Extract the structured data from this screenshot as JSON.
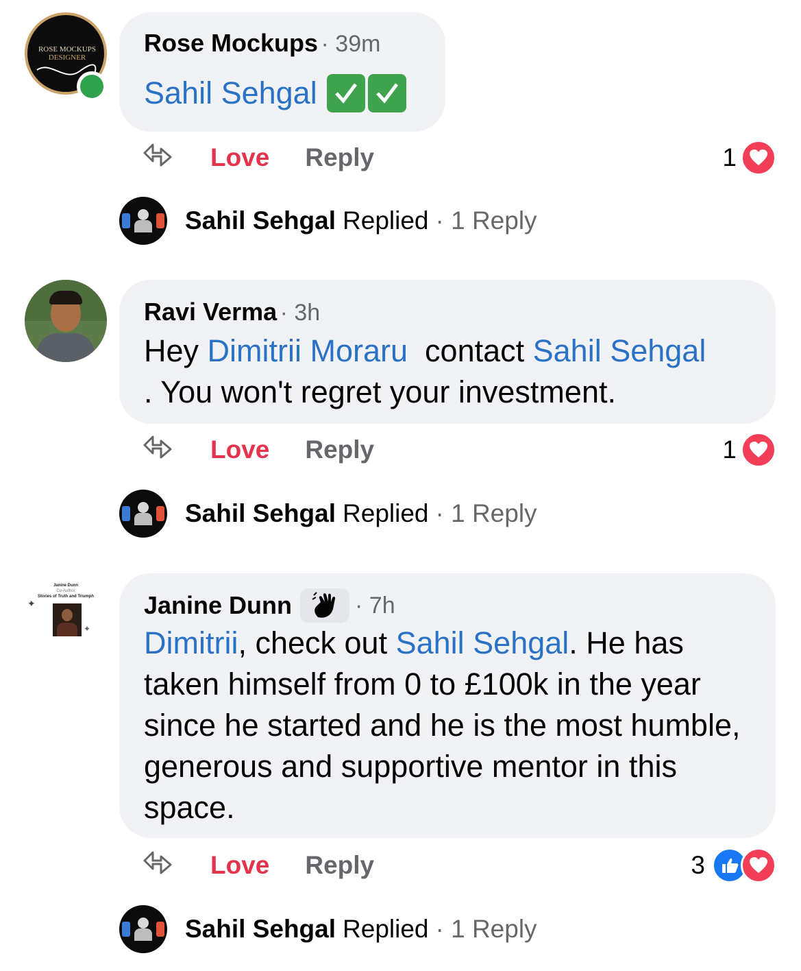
{
  "comments": [
    {
      "author": "Rose Mockups",
      "time": "· 39m",
      "avatar_text": [
        "ROSE MOCKUPS",
        "DESIGNER"
      ],
      "body_mention": "Sahil Sehgal",
      "online": true,
      "actions": {
        "love": "Love",
        "reply": "Reply"
      },
      "reaction_count": "1",
      "replied": {
        "name": "Sahil Sehgal",
        "word": "Replied",
        "count": "· 1 Reply"
      }
    },
    {
      "author": "Ravi Verma",
      "time": "· 3h",
      "body_parts": [
        "Hey ",
        "Dimitrii Moraru",
        "  contact ",
        "Sahil Sehgal",
        ". You won't regret your investment."
      ],
      "actions": {
        "love": "Love",
        "reply": "Reply"
      },
      "reaction_count": "1",
      "replied": {
        "name": "Sahil Sehgal",
        "word": "Replied",
        "count": "· 1 Reply"
      }
    },
    {
      "author": "Janine Dunn",
      "time": "· 7h",
      "avatar_text": [
        "Janine Dunn",
        "Co-Author",
        "Stories of Truth and Triumph"
      ],
      "body_parts": [
        "Dimitrii",
        ", check out ",
        "Sahil Sehgal",
        ". He has taken himself from 0 to £100k in the year since he started and he is the most humble, generous and supportive mentor in this space."
      ],
      "actions": {
        "love": "Love",
        "reply": "Reply"
      },
      "reaction_count": "3",
      "replied": {
        "name": "Sahil Sehgal",
        "word": "Replied",
        "count": "· 1 Reply"
      }
    }
  ],
  "icons": {
    "share": "share-icon",
    "heart": "heart-reaction-icon",
    "like": "like-reaction-icon",
    "wave": "wave-badge-icon",
    "check": "check-mark-icon"
  },
  "colors": {
    "mention": "#2a72c5",
    "love": "#e4334c",
    "bubble": "#f0f2f5",
    "online": "#31a24c"
  }
}
